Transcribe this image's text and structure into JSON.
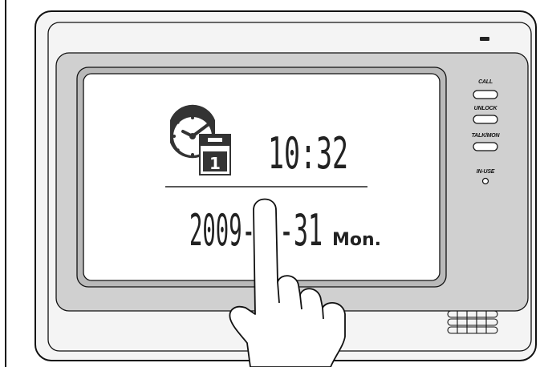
{
  "display": {
    "time": "10:32",
    "date": "2009-",
    "date_tail": "-31",
    "weekday": "Mon.",
    "calendar_day": "1"
  },
  "side_buttons": [
    {
      "label": "CALL"
    },
    {
      "label": "UNLOCK"
    },
    {
      "label": "TALK/MON"
    }
  ],
  "indicator": {
    "label": "IN-USE"
  },
  "icons": {
    "clock": "clock-icon",
    "calendar": "calendar-icon",
    "hand": "pointing-hand-icon",
    "speaker": "speaker-grille-icon"
  },
  "colors": {
    "housing": "#f2f2f2",
    "screen_bezel": "#cfcfcf",
    "screen": "#ffffff",
    "ink": "#111111"
  }
}
